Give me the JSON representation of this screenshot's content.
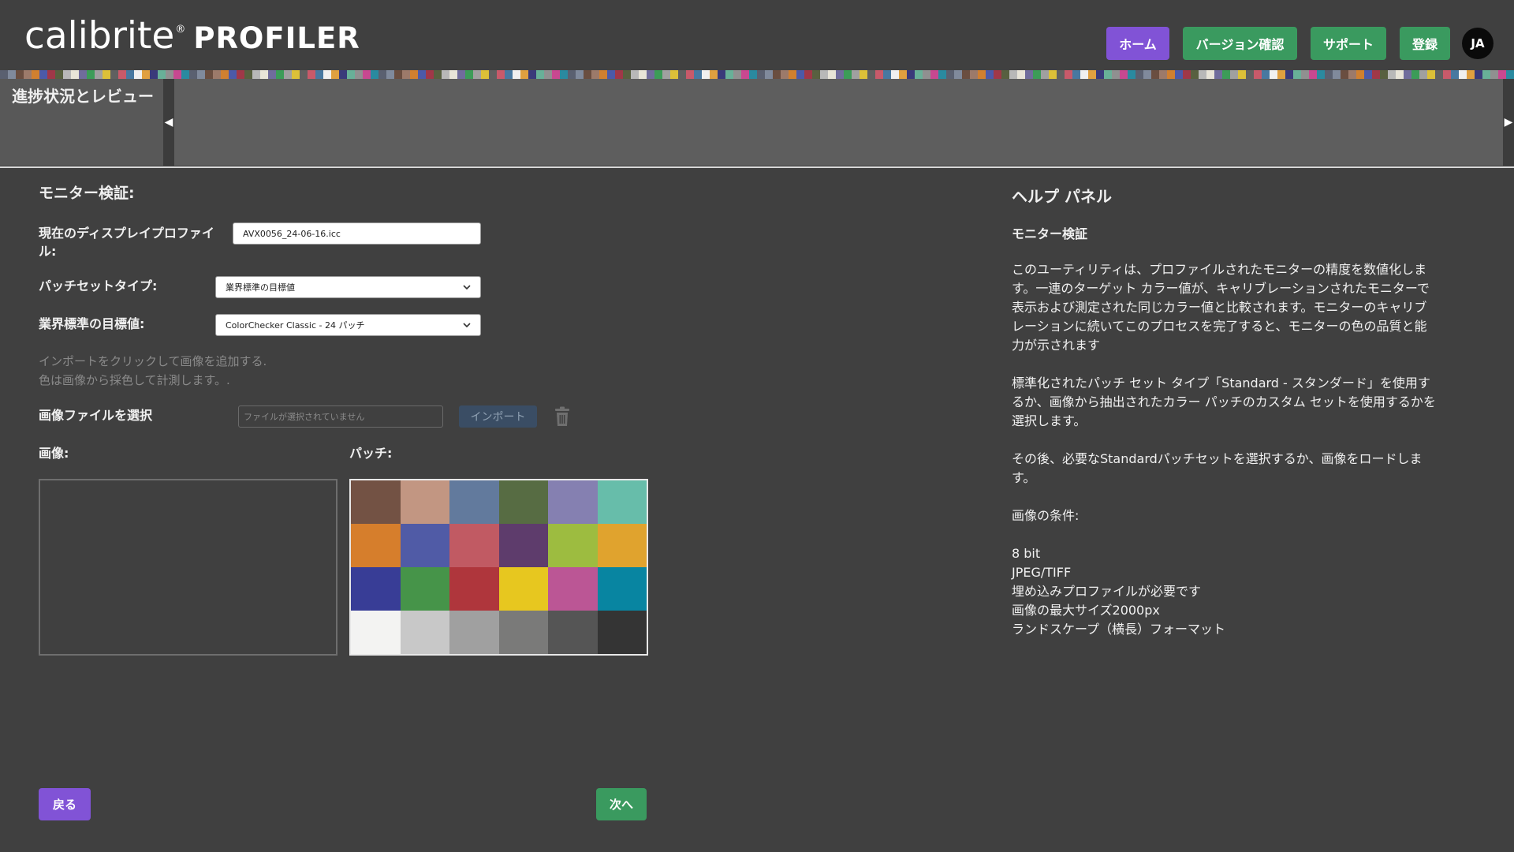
{
  "header": {
    "brand": "calibrite",
    "brand_mark": "®",
    "product": "PROFILER",
    "nav": [
      {
        "label": "ホーム",
        "style": "purple"
      },
      {
        "label": "バージョン確認",
        "style": "green"
      },
      {
        "label": "サポート",
        "style": "green"
      },
      {
        "label": "登録",
        "style": "green"
      }
    ],
    "avatar": "JA"
  },
  "progress": {
    "title": "進捗状況とレビュー"
  },
  "form": {
    "section_title": "モニター検証:",
    "profile_label": "現在のディスプレイプロファイル:",
    "profile_value": "AVX0056_24-06-16.icc",
    "patch_type_label": "パッチセットタイプ:",
    "patch_type_value": "業界標準の目標値",
    "standard_label": "業界標準の目標値:",
    "standard_value": "ColorChecker Classic - 24 パッチ",
    "hint_line1": "インポートをクリックして画像を追加する.",
    "hint_line2": "色は画像から採色して計測します。.",
    "file_label": "画像ファイルを選択",
    "file_placeholder": "ファイルが選択されていません",
    "import_label": "インポート",
    "image_label": "画像:",
    "patches_label": "パッチ:",
    "patches": [
      "#735244",
      "#c29682",
      "#627a9d",
      "#576c43",
      "#8580b1",
      "#67bdaa",
      "#d67e2c",
      "#505ba6",
      "#c15a63",
      "#5e3c6c",
      "#9dbc40",
      "#e0a32e",
      "#383d96",
      "#469449",
      "#af363c",
      "#e7c71f",
      "#bb5695",
      "#0885a1",
      "#f3f3f2",
      "#c8c8c8",
      "#a0a0a0",
      "#7a7a79",
      "#555555",
      "#343434"
    ],
    "back_label": "戻る",
    "next_label": "次へ"
  },
  "help": {
    "title": "ヘルプ パネル",
    "subtitle": "モニター検証",
    "p1": "このユーティリティは、プロファイルされたモニターの精度を数値化します。一連のターゲット カラー値が、キャリブレーションされたモニターで表示および測定された同じカラー値と比較されます。モニターのキャリブレーションに続いてこのプロセスを完了すると、モニターの色の品質と能力が示されます",
    "p2": "標準化されたパッチ セット タイプ「Standard - スタンダード」を使用するか、画像から抽出されたカラー パッチのカスタム セットを使用するかを選択します。",
    "p3": "その後、必要なStandardパッチセットを選択するか、画像をロードします。",
    "requirements_title": "画像の条件:",
    "requirements": [
      "8 bit",
      "JPEG/TIFF",
      "埋め込みプロファイルが必要です",
      "画像の最大サイズ2000px",
      "ランドスケープ（横長）フォーマット"
    ]
  },
  "colors": {
    "background": "#404040",
    "accent_purple": "#8153d6",
    "accent_green": "#3a9a5f"
  }
}
